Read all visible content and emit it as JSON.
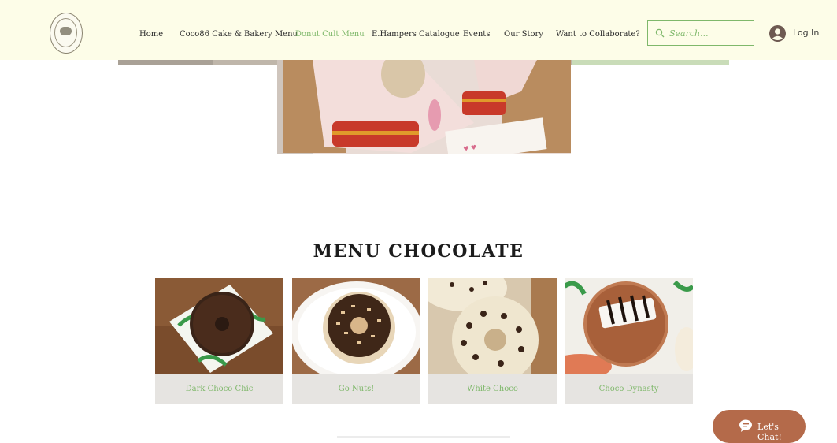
{
  "header": {
    "nav": [
      {
        "label": "Home",
        "active": false
      },
      {
        "label": "Coco86 Cake & Bakery Menu",
        "active": false
      },
      {
        "label": "Donut Cult Menu",
        "active": true
      },
      {
        "label": "E.Hampers Catalogue",
        "active": false
      },
      {
        "label": "Events",
        "active": false
      },
      {
        "label": "Our Story",
        "active": false
      },
      {
        "label": "Want to Collaborate?",
        "active": false
      }
    ],
    "search_placeholder": "Search...",
    "login_label": "Log In"
  },
  "section": {
    "title": "MENU CHOCOLATE",
    "items": [
      {
        "name": "Dark Choco Chic"
      },
      {
        "name": "Go Nuts!"
      },
      {
        "name": "White Choco"
      },
      {
        "name": "Choco Dynasty"
      }
    ]
  },
  "chat": {
    "label": "Let's Chat!"
  },
  "colors": {
    "accent": "#7fb86b",
    "header_bg": "#fdfde8",
    "chat_bg": "#b46a4a"
  }
}
